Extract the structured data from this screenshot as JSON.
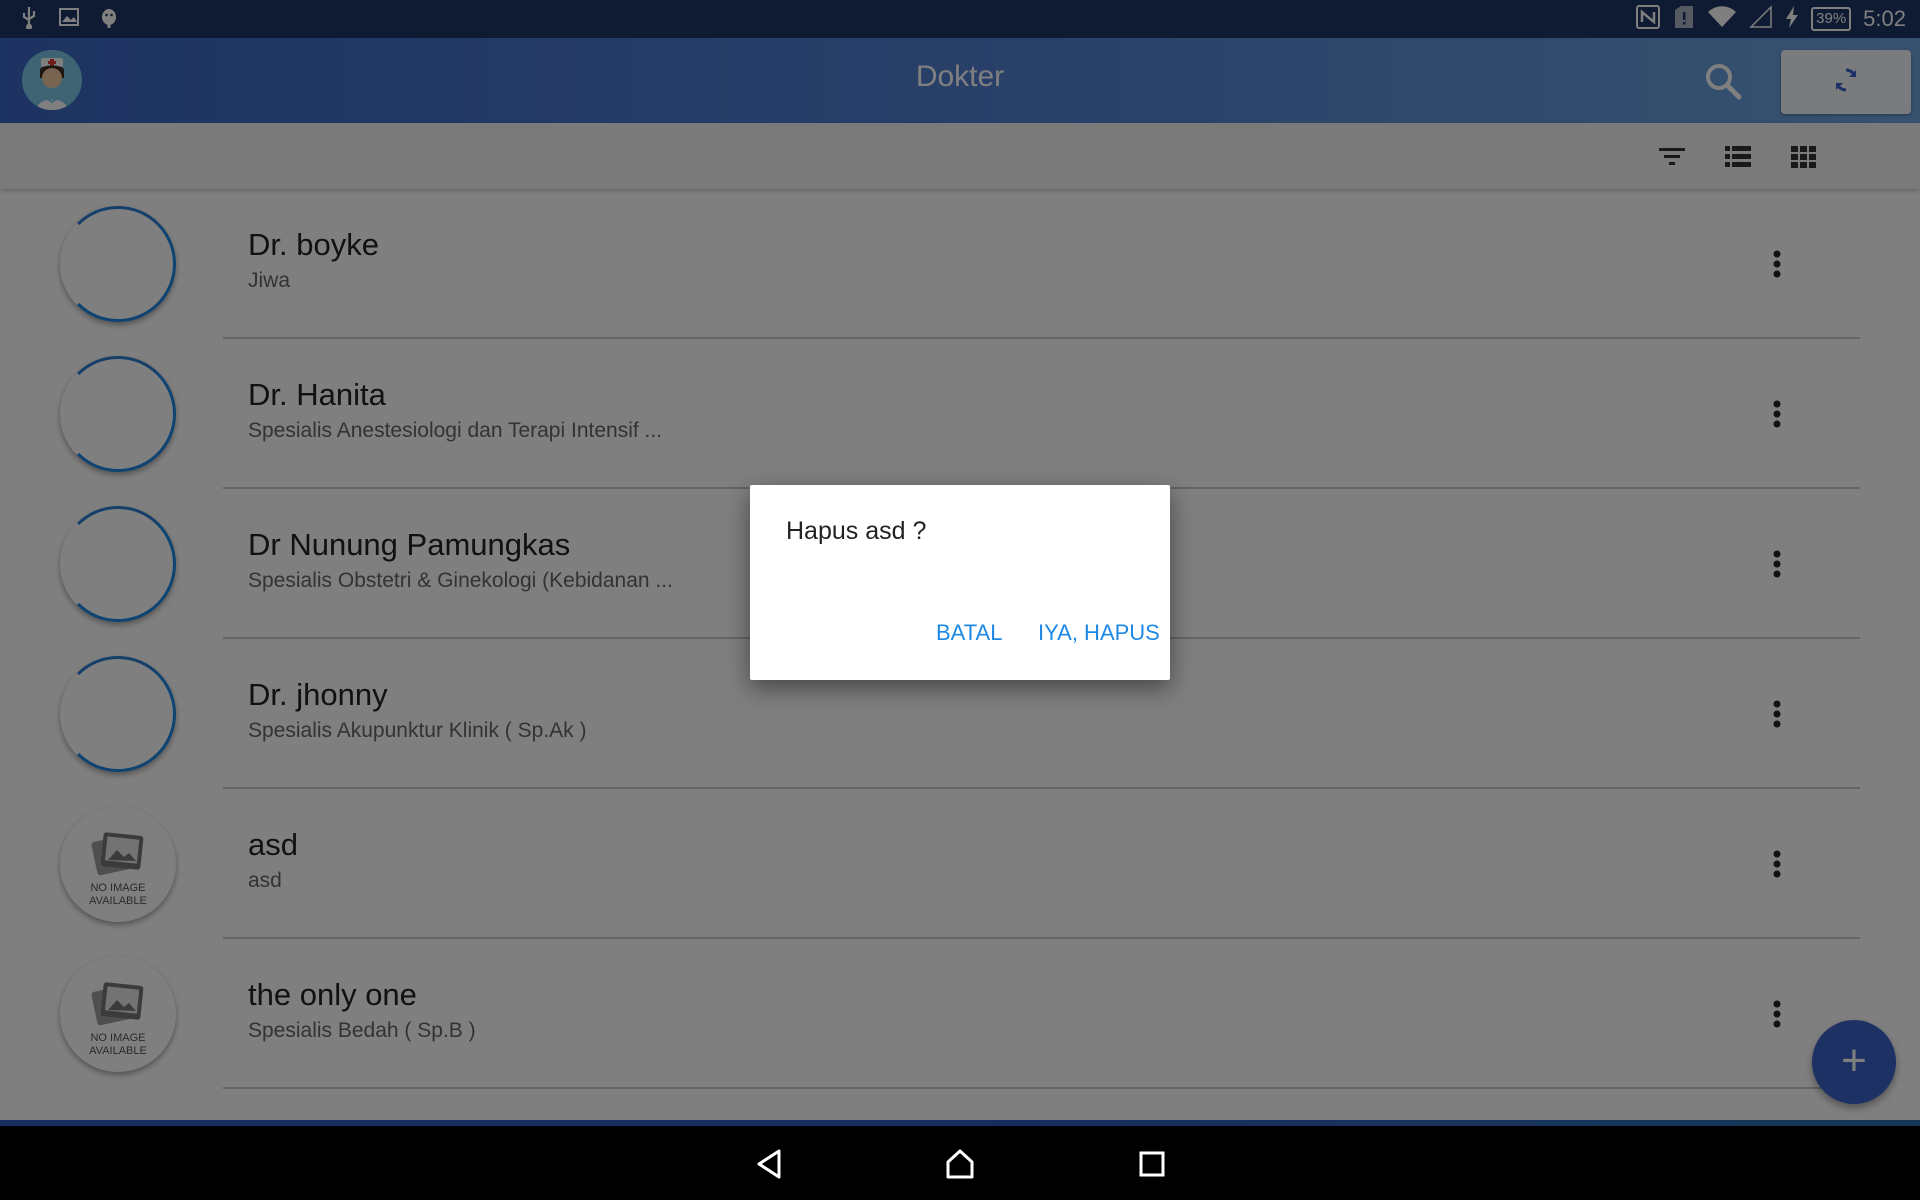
{
  "status_bar": {
    "left_icons": [
      "usb-icon",
      "image-icon",
      "android-debug-icon"
    ],
    "right_icons": [
      "nfc-icon",
      "sim-alert-icon",
      "wifi-icon",
      "signal-icon",
      "charging-icon"
    ],
    "battery": "39%",
    "time": "5:02"
  },
  "app_bar": {
    "title": "Dokter",
    "icons": [
      "nurse-avatar-icon",
      "search-icon",
      "sync-icon"
    ]
  },
  "toolbar": {
    "icons": [
      "filter-icon",
      "list-view-icon",
      "grid-view-icon"
    ]
  },
  "doctors": [
    {
      "name": "Dr. boyke",
      "specialty": "Jiwa",
      "photo": "loading"
    },
    {
      "name": "Dr. Hanita",
      "specialty": "Spesialis Anestesiologi dan Terapi Intensif ...",
      "photo": "loading"
    },
    {
      "name": "Dr Nunung Pamungkas",
      "specialty": "Spesialis Obstetri & Ginekologi (Kebidanan ...",
      "photo": "loading"
    },
    {
      "name": "Dr. jhonny",
      "specialty": "Spesialis Akupunktur Klinik ( Sp.Ak )",
      "photo": "loading"
    },
    {
      "name": "asd",
      "specialty": "asd",
      "photo": "none"
    },
    {
      "name": "the only one",
      "specialty": "Spesialis Bedah ( Sp.B )",
      "photo": "none"
    }
  ],
  "no_image": {
    "line1": "NO IMAGE",
    "line2": "AVAILABLE"
  },
  "fab": {
    "label": "+"
  },
  "dialog": {
    "message": "Hapus asd ?",
    "cancel": "BATAL",
    "confirm": "IYA, HAPUS"
  },
  "nav_bar": {
    "icons": [
      "back-icon",
      "home-icon",
      "recents-icon"
    ]
  },
  "colors": {
    "accent": "#1e88e5",
    "app_bar": "#3b66c2",
    "fab": "#3d63c8"
  }
}
